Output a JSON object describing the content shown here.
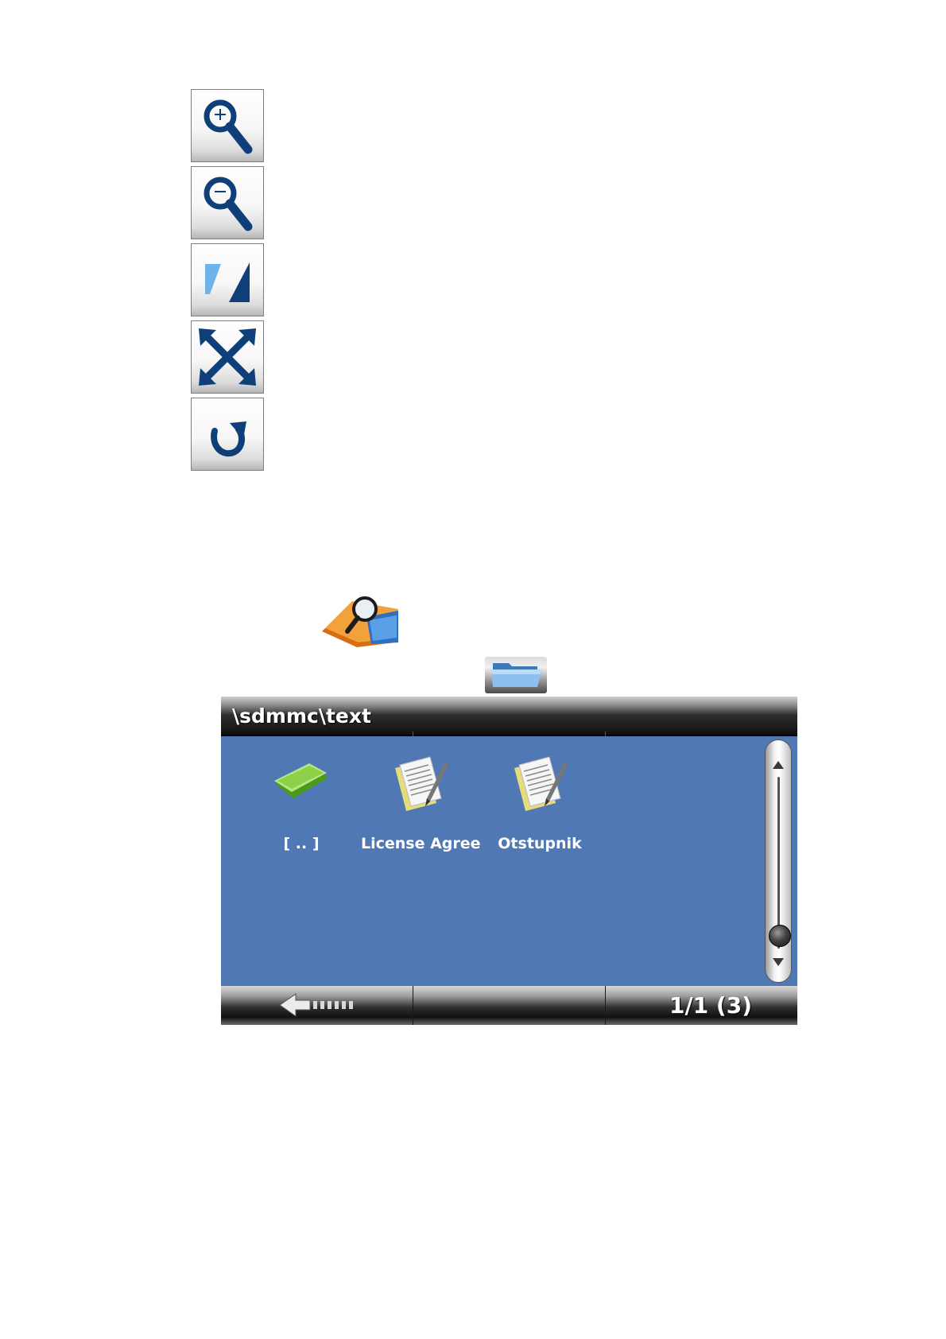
{
  "toolbar": {
    "buttons": [
      {
        "name": "zoom-in-button",
        "icon": "zoom-in-icon"
      },
      {
        "name": "zoom-out-button",
        "icon": "zoom-out-icon"
      },
      {
        "name": "contrast-button",
        "icon": "contrast-icon"
      },
      {
        "name": "fullscreen-button",
        "icon": "expand-arrows-icon"
      },
      {
        "name": "rotate-button",
        "icon": "rotate-icon"
      }
    ]
  },
  "app_icons": {
    "document_viewer_icon": "document-search-icon",
    "open_folder_icon": "folder-open-icon"
  },
  "browser": {
    "path": "\\sdmmc\\text",
    "items": [
      {
        "label": "[ .. ]",
        "icon": "parent-folder-icon"
      },
      {
        "label": "License Agreement",
        "icon": "text-document-icon"
      },
      {
        "label": "Otstupnik",
        "icon": "text-document-icon"
      }
    ],
    "footer": {
      "back_icon": "back-arrow-icon",
      "page_count": "1/1 (3)"
    }
  },
  "colors": {
    "browser_background": "#5078b4",
    "icon_blue": "#0f3f78"
  }
}
